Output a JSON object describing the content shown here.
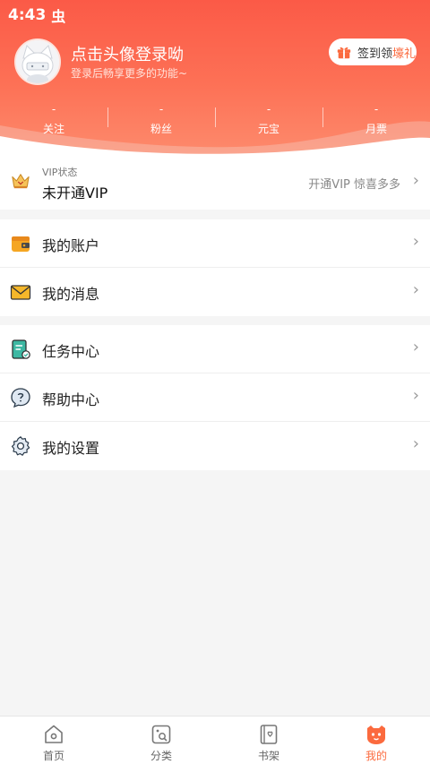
{
  "status_bar": {
    "time": "4:43",
    "notification_glyph": "虫"
  },
  "profile": {
    "title": "点击头像登录呦",
    "subtitle": "登录后畅享更多的功能~",
    "avatar_icon": "cat-avatar-icon"
  },
  "signin": {
    "prefix": "签到领",
    "highlight": "壕礼"
  },
  "stats": [
    {
      "value": "-",
      "label": "关注"
    },
    {
      "value": "-",
      "label": "粉丝"
    },
    {
      "value": "-",
      "label": "元宝"
    },
    {
      "value": "-",
      "label": "月票"
    }
  ],
  "vip": {
    "label": "VIP状态",
    "status": "未开通VIP",
    "promo": "开通VIP 惊喜多多"
  },
  "menu_group_1": [
    {
      "label": "我的账户",
      "icon": "wallet-icon"
    },
    {
      "label": "我的消息",
      "icon": "envelope-icon"
    }
  ],
  "menu_group_2": [
    {
      "label": "任务中心",
      "icon": "task-icon"
    },
    {
      "label": "帮助中心",
      "icon": "help-icon"
    },
    {
      "label": "我的设置",
      "icon": "gear-icon"
    }
  ],
  "tabs": [
    {
      "label": "首页",
      "icon": "home-icon",
      "active": false
    },
    {
      "label": "分类",
      "icon": "category-icon",
      "active": false
    },
    {
      "label": "书架",
      "icon": "bookshelf-icon",
      "active": false
    },
    {
      "label": "我的",
      "icon": "profile-icon",
      "active": true
    }
  ],
  "colors": {
    "accent": "#fb6a3e",
    "header_top": "#fb5a47",
    "header_bottom": "#fd8a6c"
  }
}
